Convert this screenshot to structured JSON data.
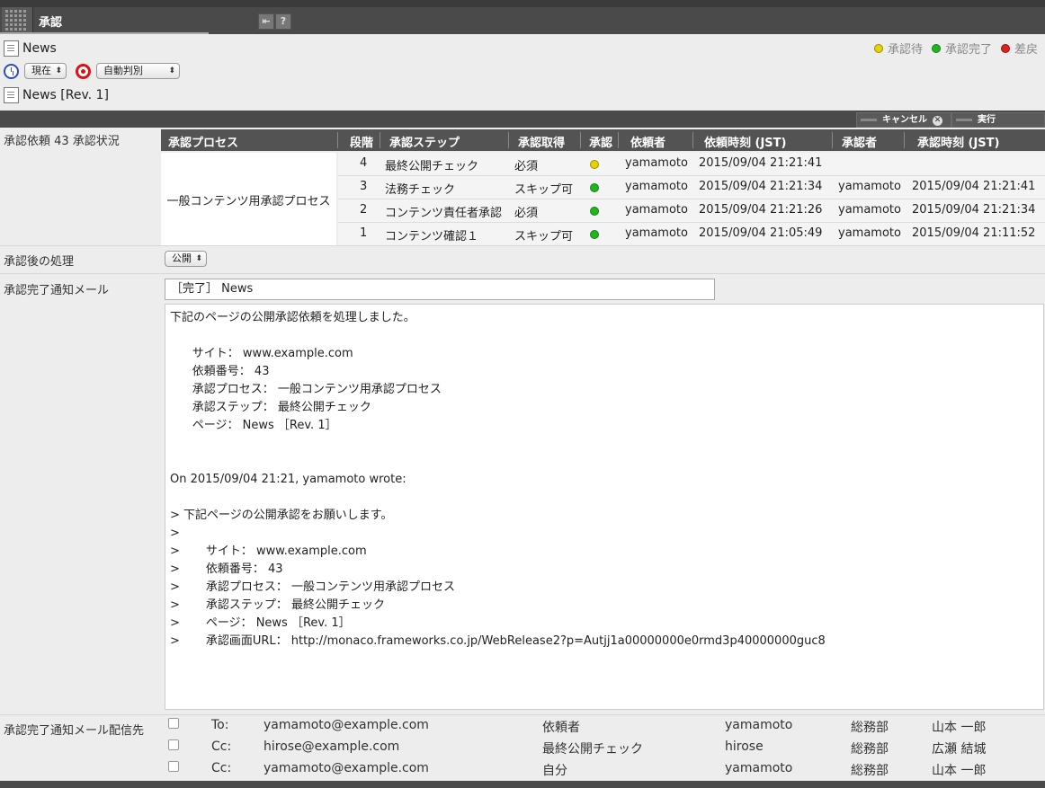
{
  "window": {
    "title": "承認",
    "tools": [
      "⇤",
      "?"
    ]
  },
  "document": {
    "title": "News",
    "time_select": "現在",
    "mode_select": "自動判別",
    "revision": "News [Rev. 1]"
  },
  "legend": {
    "waiting": "承認待",
    "done": "承認完了",
    "returned": "差戻",
    "colors": {
      "waiting": "#e6d400",
      "done": "#22b522",
      "returned": "#d22222"
    }
  },
  "actions": {
    "cancel": "キャンセル",
    "execute": "実行"
  },
  "status": {
    "label": "承認依頼 43 承認状況",
    "headers": [
      "承認プロセス",
      "段階",
      "承認ステップ",
      "承認取得",
      "承認",
      "依頼者",
      "依頼時刻 (JST)",
      "承認者",
      "承認時刻 (JST)"
    ],
    "process_name": "一般コンテンツ用承認プロセス",
    "rows": [
      {
        "stage": "4",
        "step": "最終公開チェック",
        "acquire": "必須",
        "state": "waiting",
        "requester": "yamamoto",
        "requested_at": "2015/09/04 21:21:41",
        "approver": "",
        "approved_at": ""
      },
      {
        "stage": "3",
        "step": "法務チェック",
        "acquire": "スキップ可",
        "state": "done",
        "requester": "yamamoto",
        "requested_at": "2015/09/04 21:21:34",
        "approver": "yamamoto",
        "approved_at": "2015/09/04 21:21:41"
      },
      {
        "stage": "2",
        "step": "コンテンツ責任者承認",
        "acquire": "必須",
        "state": "done",
        "requester": "yamamoto",
        "requested_at": "2015/09/04 21:21:26",
        "approver": "yamamoto",
        "approved_at": "2015/09/04 21:21:34"
      },
      {
        "stage": "1",
        "step": "コンテンツ確認１",
        "acquire": "スキップ可",
        "state": "done",
        "requester": "yamamoto",
        "requested_at": "2015/09/04 21:05:49",
        "approver": "yamamoto",
        "approved_at": "2015/09/04 21:11:52"
      }
    ]
  },
  "after": {
    "label": "承認後の処理",
    "select": "公開"
  },
  "mail": {
    "label": "承認完了通知メール",
    "subject": "［完了］ News",
    "body_lines": [
      "下記のページの公開承認依頼を処理しました。",
      "",
      "      サイト： www.example.com",
      "      依頼番号： 43",
      "      承認プロセス： 一般コンテンツ用承認プロセス",
      "      承認ステップ： 最終公開チェック",
      "      ページ： News ［Rev. 1］",
      "",
      "",
      "On 2015/09/04 21:21, yamamoto wrote:",
      "",
      "> 下記ページの公開承認をお願いします。",
      ">",
      ">       サイト： www.example.com",
      ">       依頼番号： 43",
      ">       承認プロセス： 一般コンテンツ用承認プロセス",
      ">       承認ステップ： 最終公開チェック",
      ">       ページ： News ［Rev. 1］",
      ">       承認画面URL： http://monaco.frameworks.co.jp/WebRelease2?p=Autjj1a00000000e0rmd3p40000000guc8"
    ]
  },
  "recipients": {
    "label": "承認完了通知メール配信先",
    "rows": [
      {
        "kind": "To:",
        "email": "yamamoto@example.com",
        "role": "依頼者",
        "user": "yamamoto",
        "dept": "総務部",
        "name": "山本 一郎"
      },
      {
        "kind": "Cc:",
        "email": "hirose@example.com",
        "role": "最終公開チェック",
        "user": "hirose",
        "dept": "総務部",
        "name": "広瀬 結城"
      },
      {
        "kind": "Cc:",
        "email": "yamamoto@example.com",
        "role": "自分",
        "user": "yamamoto",
        "dept": "総務部",
        "name": "山本 一郎"
      }
    ]
  }
}
